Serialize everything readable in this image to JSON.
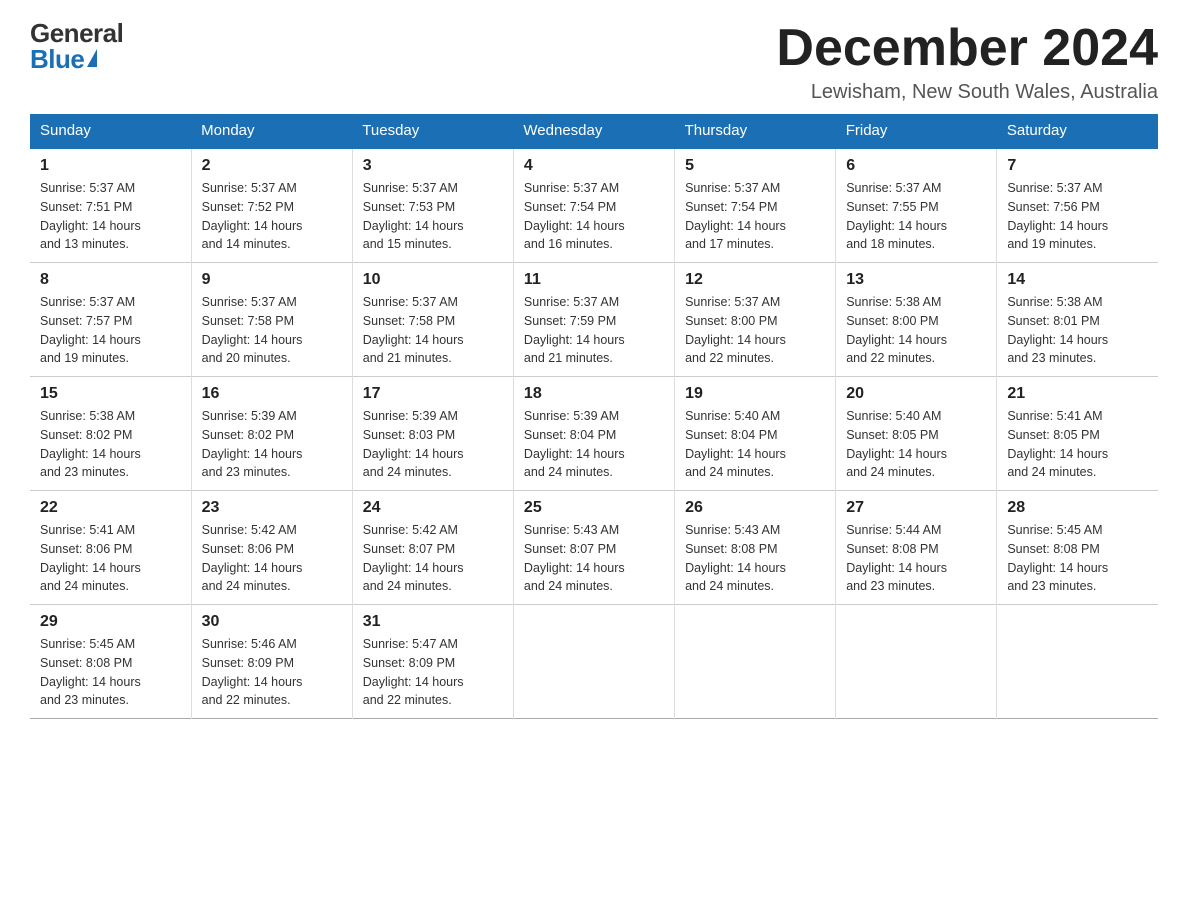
{
  "header": {
    "logo": {
      "general": "General",
      "blue": "Blue"
    },
    "title": "December 2024",
    "location": "Lewisham, New South Wales, Australia"
  },
  "calendar": {
    "weekdays": [
      "Sunday",
      "Monday",
      "Tuesday",
      "Wednesday",
      "Thursday",
      "Friday",
      "Saturday"
    ],
    "weeks": [
      [
        {
          "day": "1",
          "sunrise": "5:37 AM",
          "sunset": "7:51 PM",
          "daylight": "14 hours and 13 minutes."
        },
        {
          "day": "2",
          "sunrise": "5:37 AM",
          "sunset": "7:52 PM",
          "daylight": "14 hours and 14 minutes."
        },
        {
          "day": "3",
          "sunrise": "5:37 AM",
          "sunset": "7:53 PM",
          "daylight": "14 hours and 15 minutes."
        },
        {
          "day": "4",
          "sunrise": "5:37 AM",
          "sunset": "7:54 PM",
          "daylight": "14 hours and 16 minutes."
        },
        {
          "day": "5",
          "sunrise": "5:37 AM",
          "sunset": "7:54 PM",
          "daylight": "14 hours and 17 minutes."
        },
        {
          "day": "6",
          "sunrise": "5:37 AM",
          "sunset": "7:55 PM",
          "daylight": "14 hours and 18 minutes."
        },
        {
          "day": "7",
          "sunrise": "5:37 AM",
          "sunset": "7:56 PM",
          "daylight": "14 hours and 19 minutes."
        }
      ],
      [
        {
          "day": "8",
          "sunrise": "5:37 AM",
          "sunset": "7:57 PM",
          "daylight": "14 hours and 19 minutes."
        },
        {
          "day": "9",
          "sunrise": "5:37 AM",
          "sunset": "7:58 PM",
          "daylight": "14 hours and 20 minutes."
        },
        {
          "day": "10",
          "sunrise": "5:37 AM",
          "sunset": "7:58 PM",
          "daylight": "14 hours and 21 minutes."
        },
        {
          "day": "11",
          "sunrise": "5:37 AM",
          "sunset": "7:59 PM",
          "daylight": "14 hours and 21 minutes."
        },
        {
          "day": "12",
          "sunrise": "5:37 AM",
          "sunset": "8:00 PM",
          "daylight": "14 hours and 22 minutes."
        },
        {
          "day": "13",
          "sunrise": "5:38 AM",
          "sunset": "8:00 PM",
          "daylight": "14 hours and 22 minutes."
        },
        {
          "day": "14",
          "sunrise": "5:38 AM",
          "sunset": "8:01 PM",
          "daylight": "14 hours and 23 minutes."
        }
      ],
      [
        {
          "day": "15",
          "sunrise": "5:38 AM",
          "sunset": "8:02 PM",
          "daylight": "14 hours and 23 minutes."
        },
        {
          "day": "16",
          "sunrise": "5:39 AM",
          "sunset": "8:02 PM",
          "daylight": "14 hours and 23 minutes."
        },
        {
          "day": "17",
          "sunrise": "5:39 AM",
          "sunset": "8:03 PM",
          "daylight": "14 hours and 24 minutes."
        },
        {
          "day": "18",
          "sunrise": "5:39 AM",
          "sunset": "8:04 PM",
          "daylight": "14 hours and 24 minutes."
        },
        {
          "day": "19",
          "sunrise": "5:40 AM",
          "sunset": "8:04 PM",
          "daylight": "14 hours and 24 minutes."
        },
        {
          "day": "20",
          "sunrise": "5:40 AM",
          "sunset": "8:05 PM",
          "daylight": "14 hours and 24 minutes."
        },
        {
          "day": "21",
          "sunrise": "5:41 AM",
          "sunset": "8:05 PM",
          "daylight": "14 hours and 24 minutes."
        }
      ],
      [
        {
          "day": "22",
          "sunrise": "5:41 AM",
          "sunset": "8:06 PM",
          "daylight": "14 hours and 24 minutes."
        },
        {
          "day": "23",
          "sunrise": "5:42 AM",
          "sunset": "8:06 PM",
          "daylight": "14 hours and 24 minutes."
        },
        {
          "day": "24",
          "sunrise": "5:42 AM",
          "sunset": "8:07 PM",
          "daylight": "14 hours and 24 minutes."
        },
        {
          "day": "25",
          "sunrise": "5:43 AM",
          "sunset": "8:07 PM",
          "daylight": "14 hours and 24 minutes."
        },
        {
          "day": "26",
          "sunrise": "5:43 AM",
          "sunset": "8:08 PM",
          "daylight": "14 hours and 24 minutes."
        },
        {
          "day": "27",
          "sunrise": "5:44 AM",
          "sunset": "8:08 PM",
          "daylight": "14 hours and 23 minutes."
        },
        {
          "day": "28",
          "sunrise": "5:45 AM",
          "sunset": "8:08 PM",
          "daylight": "14 hours and 23 minutes."
        }
      ],
      [
        {
          "day": "29",
          "sunrise": "5:45 AM",
          "sunset": "8:08 PM",
          "daylight": "14 hours and 23 minutes."
        },
        {
          "day": "30",
          "sunrise": "5:46 AM",
          "sunset": "8:09 PM",
          "daylight": "14 hours and 22 minutes."
        },
        {
          "day": "31",
          "sunrise": "5:47 AM",
          "sunset": "8:09 PM",
          "daylight": "14 hours and 22 minutes."
        },
        null,
        null,
        null,
        null
      ]
    ],
    "labels": {
      "sunrise": "Sunrise:",
      "sunset": "Sunset:",
      "daylight": "Daylight:"
    }
  }
}
